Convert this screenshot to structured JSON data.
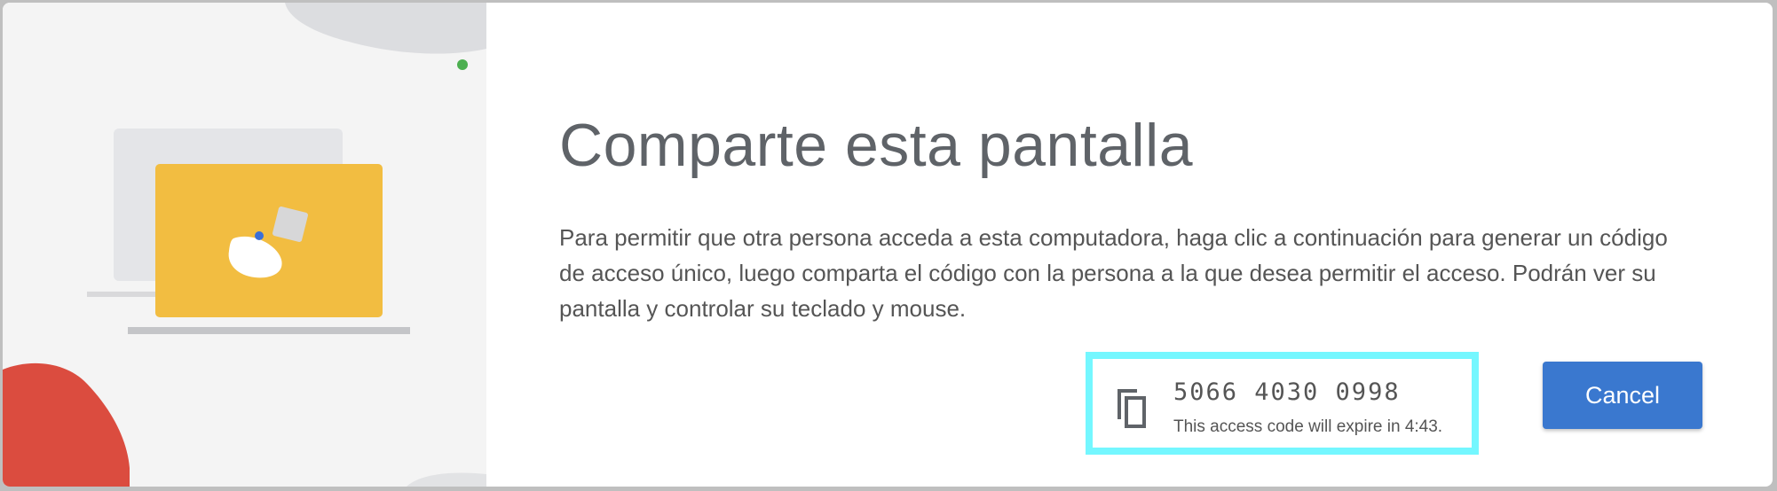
{
  "dialog": {
    "title": "Comparte esta pantalla",
    "description": "Para permitir que otra persona acceda a esta computadora, haga clic a continuación para generar un código de acceso único, luego comparta el código con la persona a la que desea permitir el acceso. Podrán ver su pantalla y controlar su teclado y mouse.",
    "access_code": "5066 4030 0998",
    "expiry_text": "This access code will expire in 4:43.",
    "cancel_label": "Cancel",
    "copy_icon": "copy-icon"
  },
  "colors": {
    "accent": "#3a78cf",
    "highlight_border": "#74f7ff",
    "title_text": "#5f6368",
    "body_text": "#555555",
    "illustration_background": "#f4f4f4",
    "laptop_yellow": "#f2bd41",
    "blob_red": "#db4c3f",
    "status_dot_green": "#4caf50"
  }
}
